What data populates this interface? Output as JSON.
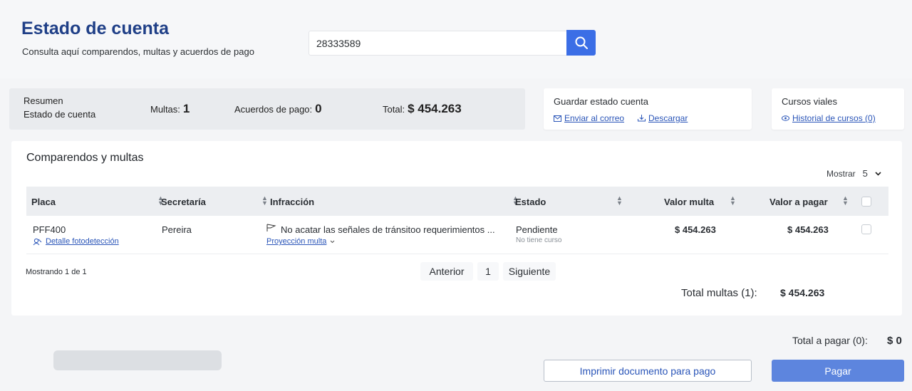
{
  "header": {
    "title": "Estado de cuenta",
    "subtitle": "Consulta aquí comparendos, multas y acuerdos de pago",
    "search_value": "28333589"
  },
  "summary": {
    "label_line1": "Resumen",
    "label_line2": "Estado de cuenta",
    "multas_label": "Multas:",
    "multas_value": "1",
    "acuerdos_label": "Acuerdos de pago:",
    "acuerdos_value": "0",
    "total_label": "Total:",
    "total_value": "$ 454.263"
  },
  "save_card": {
    "title": "Guardar estado cuenta",
    "email_link": "Enviar al correo",
    "download_link": "Descargar"
  },
  "courses_card": {
    "title": "Cursos viales",
    "history_link": "Historial de cursos (0)"
  },
  "table": {
    "title": "Comparendos y multas",
    "show_label": "Mostrar",
    "show_value": "5",
    "columns": [
      "Placa",
      "Secretaría",
      "Infracción",
      "Estado",
      "Valor multa",
      "Valor a pagar"
    ],
    "rows": [
      {
        "placa": "PFF400",
        "detalle_link": "Detalle fotodetección",
        "secretaria": "Pereira",
        "infraccion": "No acatar las señales de tránsitoo requerimientos ...",
        "proyeccion_link": "Proyección multa",
        "estado": "Pendiente",
        "estado_sub": "No tiene curso",
        "valor_multa": "$ 454.263",
        "valor_pagar": "$ 454.263"
      }
    ],
    "showing": "Mostrando 1 de 1",
    "prev": "Anterior",
    "page": "1",
    "next": "Siguiente",
    "total_label": "Total multas (1):",
    "total_value": "$ 454.263"
  },
  "footer": {
    "total_pay_label": "Total a pagar (0):",
    "total_pay_value": "$ 0",
    "print_button": "Imprimir documento para pago",
    "pay_button": "Pagar"
  },
  "colors": {
    "brand": "#1f3f87",
    "accent": "#3b6ee6",
    "link": "#2a55b8"
  }
}
